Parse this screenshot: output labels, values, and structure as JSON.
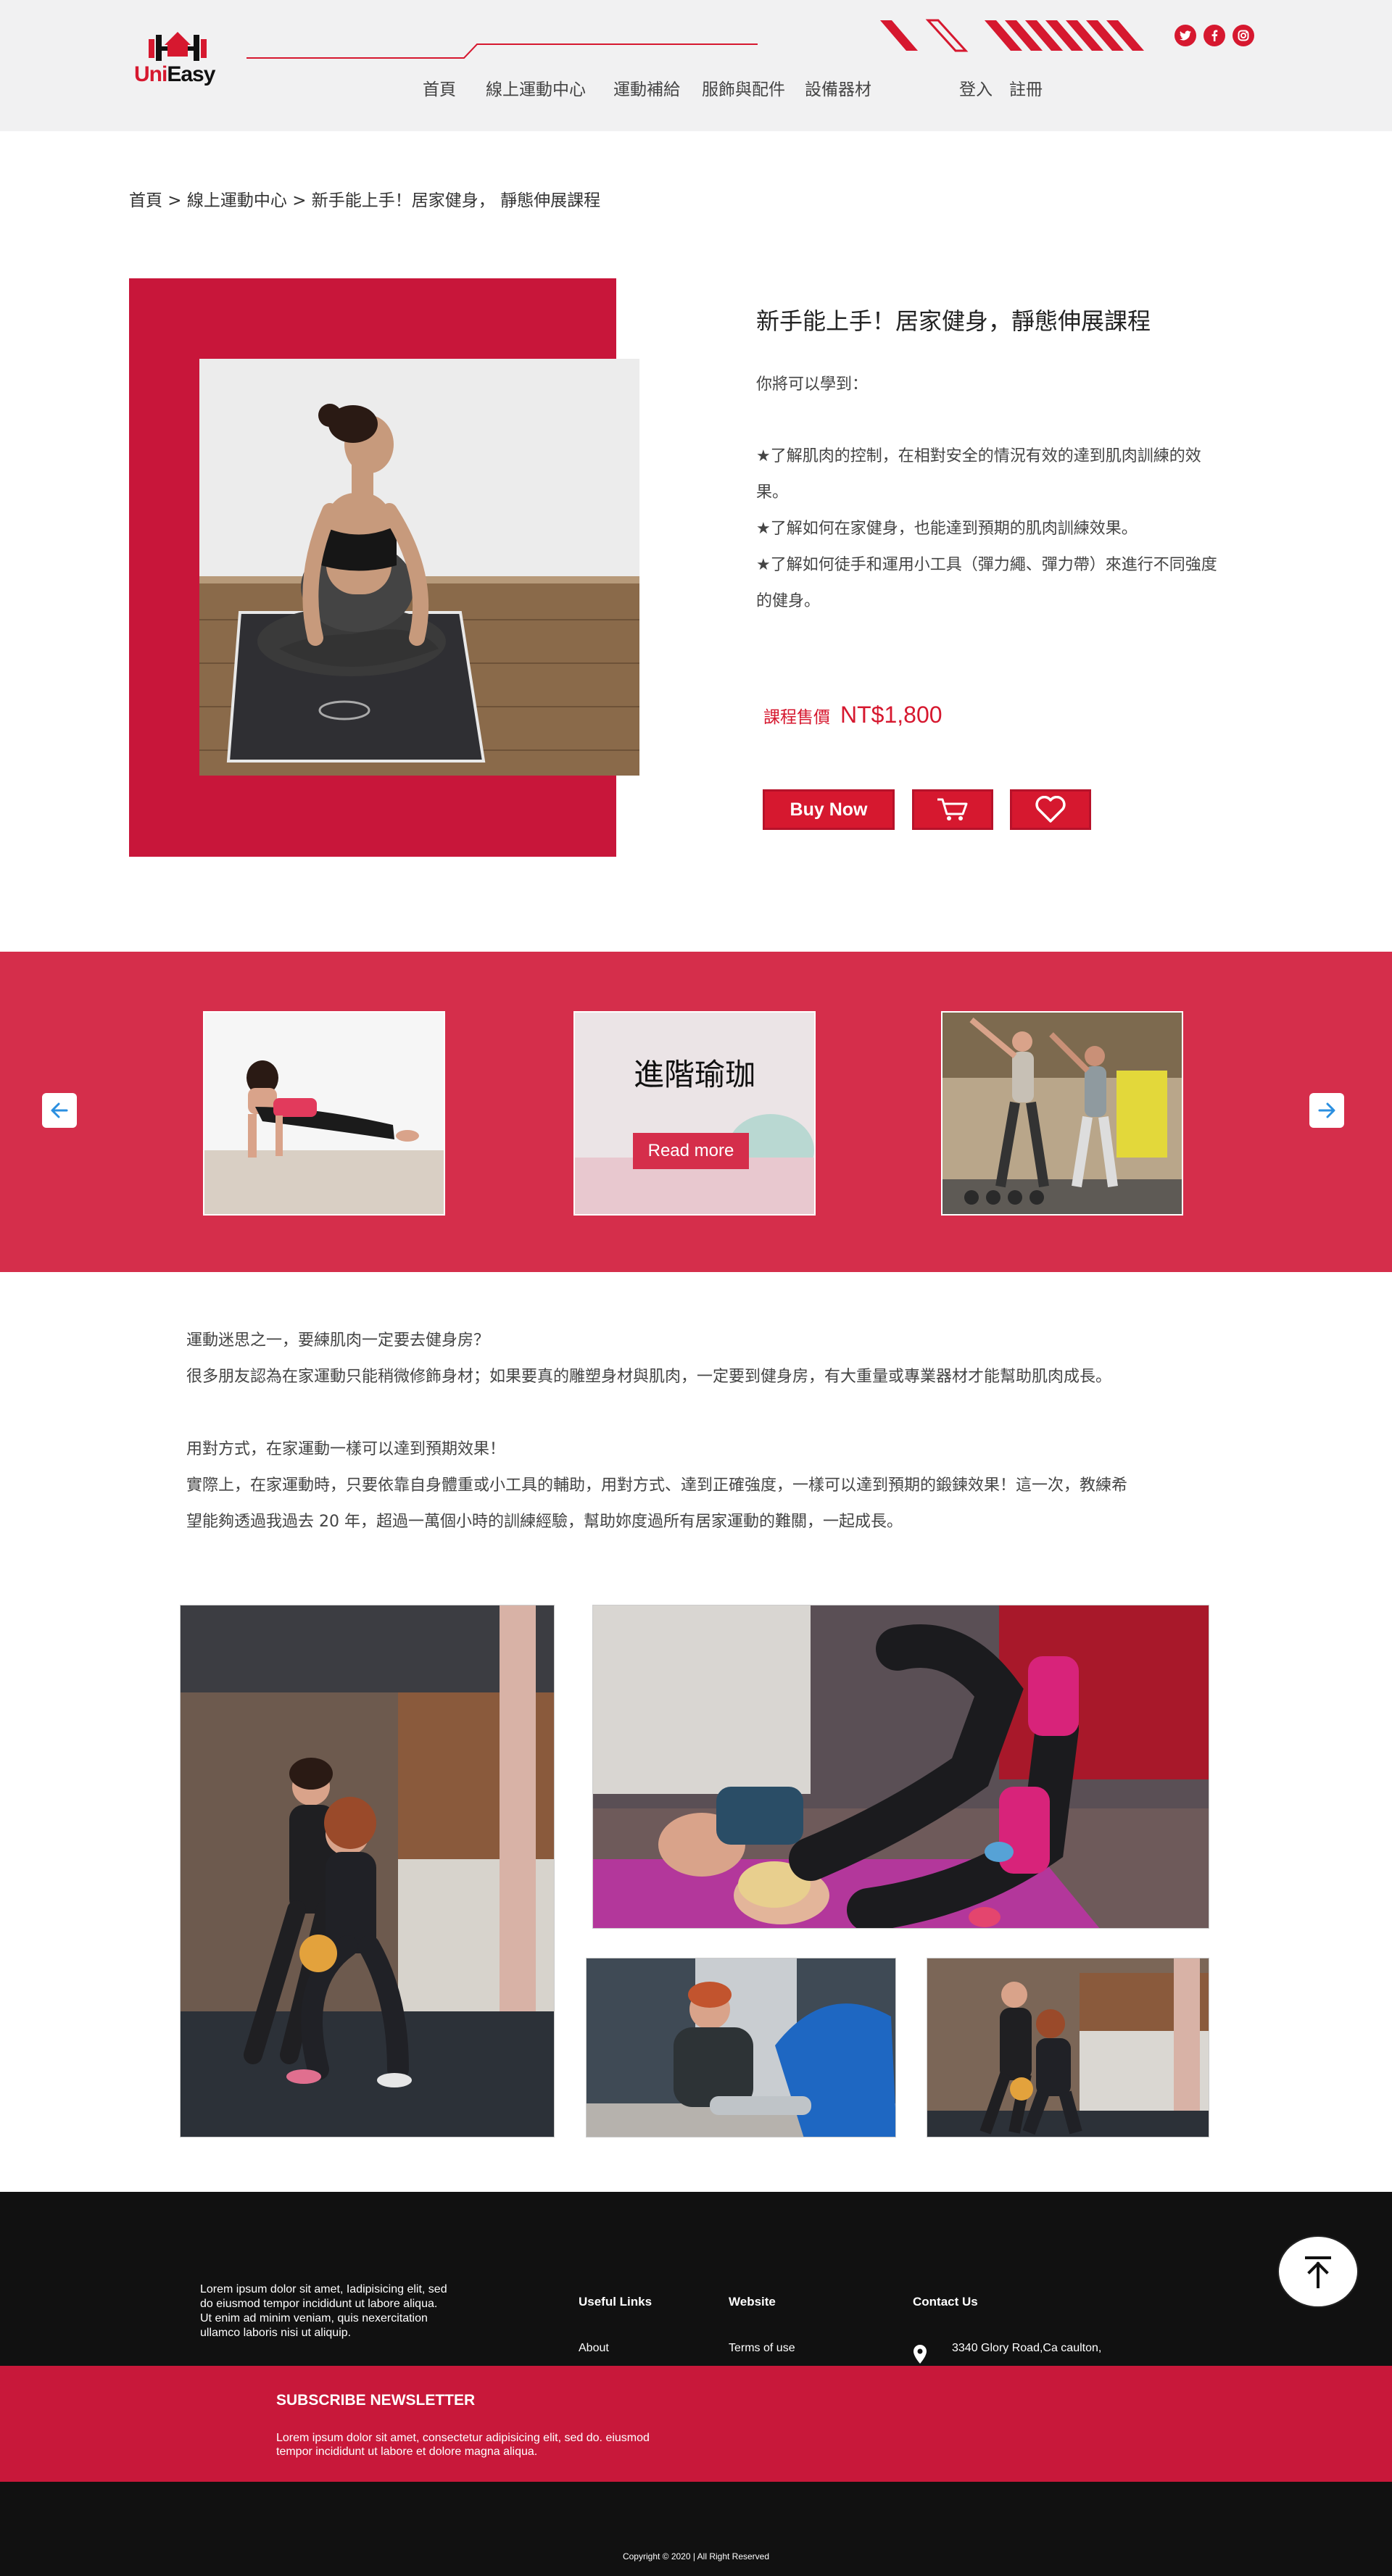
{
  "header": {
    "logo": {
      "uni": "Uni",
      "easy": "Easy"
    },
    "socials": [
      "twitter-icon",
      "facebook-icon",
      "instagram-icon"
    ],
    "nav": [
      "首頁",
      "線上運動中心",
      "運動補給",
      "服飾與配件",
      "設備器材"
    ],
    "auth": {
      "login": "登入",
      "register": "註冊"
    }
  },
  "breadcrumb": "首頁 > 線上運動中心 > 新手能上手！居家健身， 靜態伸展課程",
  "product": {
    "title": "新手能上手！居家健身，靜態伸展課程",
    "learn_label": "你將可以學到：",
    "bullets": [
      "★了解肌肉的控制，在相對安全的情況有效的達到肌肉訓練的效",
      "果。",
      "★了解如何在家健身，也能達到預期的肌肉訓練效果。",
      "★了解如何徒手和運用小工具（彈力繩、彈力帶）來進行不同強度",
      "的健身。"
    ],
    "price_label": "課程售價",
    "price": "NT$1,800",
    "buy_label": "Buy Now"
  },
  "carousel": {
    "slide_title": "進階瑜珈",
    "read_more": "Read more"
  },
  "article": {
    "lines": [
      "運動迷思之一，要練肌肉一定要去健身房？",
      "很多朋友認為在家運動只能稍微修飾身材；如果要真的雕塑身材與肌肉，一定要到健身房，有大重量或專業器材才能幫助肌肉成長。",
      "用對方式，在家運動一樣可以達到預期效果！",
      "實際上，在家運動時，只要依靠自身體重或小工具的輔助，用對方式、達到正確強度，一樣可以達到預期的鍛鍊效果！這一次，教練希",
      "望能夠透過我過去 20 年，超過一萬個小時的訓練經驗，幫助妳度過所有居家運動的難關，一起成長。"
    ]
  },
  "footer": {
    "about": "Lorem ipsum dolor sit amet, Iadipisicing elit, sed do eiusmod tempor incididunt ut labore aliqua. Ut enim ad minim veniam, quis nexercitation ullamco laboris nisi ut aliquip.",
    "useful_links_title": "Useful Links",
    "useful_link": "About",
    "website_title": "Website",
    "website_link": "Terms of use",
    "contact_title": "Contact Us",
    "address": "3340  Glory Road,Ca caulton,",
    "newsletter_title": "SUBSCRIBE NEWSLETTER",
    "newsletter_text": "Lorem ipsum dolor sit amet, consectetur adipisicing elit, sed do. eiusmod tempor incididunt ut labore et dolore magna aliqua.",
    "copyright": "Copyright © 2020 |  All Right Reserved"
  },
  "colors": {
    "brand_red": "#d6182f",
    "carousel_red": "#d52e4b",
    "footer_black": "#111111"
  }
}
